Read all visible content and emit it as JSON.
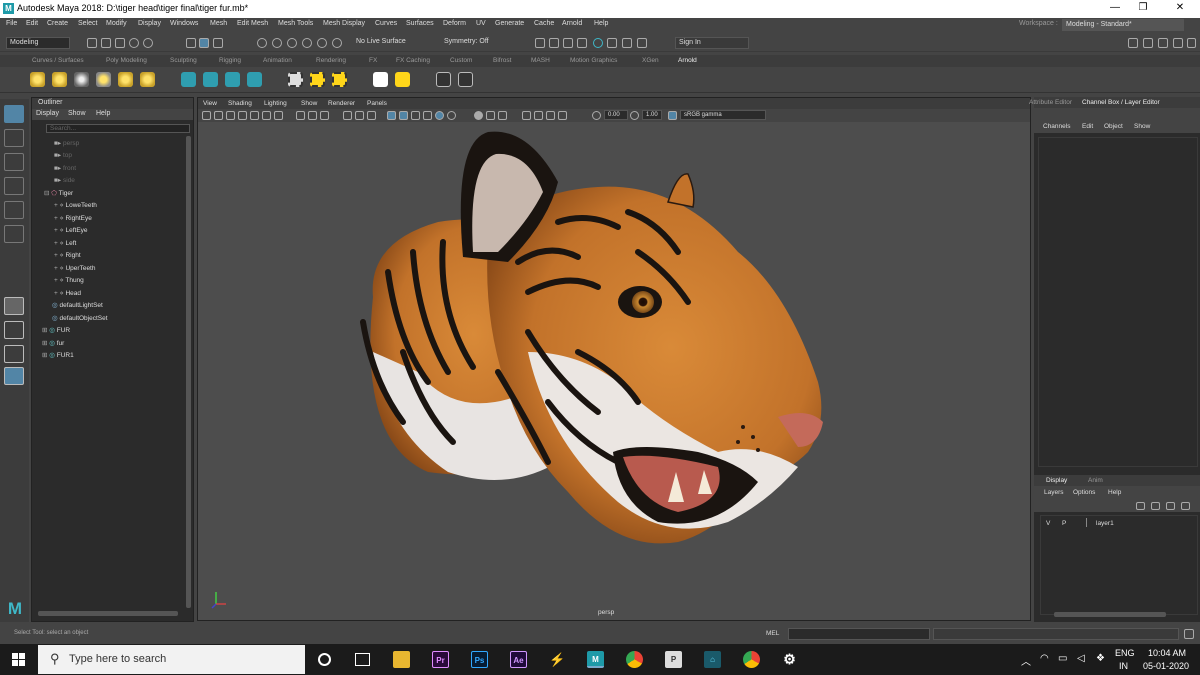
{
  "window": {
    "title": "Autodesk Maya 2018: D:\\tiger head\\tiger final\\tiger fur.mb*",
    "logo": "M",
    "minimize": "—",
    "maximize": "❐",
    "close": "✕"
  },
  "menu": [
    "File",
    "Edit",
    "Create",
    "Select",
    "Modify",
    "Display",
    "Windows",
    "Mesh",
    "Edit Mesh",
    "Mesh Tools",
    "Mesh Display",
    "Curves",
    "Surfaces",
    "Deform",
    "UV",
    "Generate",
    "Cache",
    "Arnold",
    "Help"
  ],
  "workspace": {
    "label": "Workspace :",
    "value": "Modeling - Standard*"
  },
  "statusline": {
    "mode": "Modeling",
    "live_surface": "No Live Surface",
    "symmetry": "Symmetry: Off",
    "sign_in": "Sign In"
  },
  "shelf_tabs": [
    "Curves / Surfaces",
    "Poly Modeling",
    "Sculpting",
    "Rigging",
    "Animation",
    "Rendering",
    "FX",
    "FX Caching",
    "Custom",
    "Bifrost",
    "MASH",
    "Motion Graphics",
    "XGen",
    "Arnold"
  ],
  "outliner": {
    "title": "Outliner",
    "menu": [
      "Display",
      "Show",
      "Help"
    ],
    "search_placeholder": "Search...",
    "cameras": [
      "persp",
      "top",
      "front",
      "side"
    ],
    "group": "Tiger",
    "children": [
      "LoweTeeth",
      "RightEye",
      "LeftEye",
      "Left",
      "Right",
      "UperTeeth",
      "Thung",
      "Head"
    ],
    "sets": [
      "defaultLightSet",
      "defaultObjectSet"
    ],
    "extras": [
      "FUR",
      "fur",
      "FUR1"
    ]
  },
  "viewport": {
    "menu": [
      "View",
      "Shading",
      "Lighting",
      "Show",
      "Renderer",
      "Panels"
    ],
    "field1": "0.00",
    "field2": "1.00",
    "colorspace": "sRGB gamma",
    "camera_label": "persp"
  },
  "channel_box": {
    "tab1": "Attribute Editor",
    "tab2": "Channel Box / Layer Editor",
    "menu": [
      "Channels",
      "Edit",
      "Object",
      "Show"
    ],
    "layer_tabs": [
      "Display",
      "Anim"
    ],
    "layer_menu": [
      "Layers",
      "Options",
      "Help"
    ],
    "layer": {
      "v": "V",
      "p": "P",
      "name": "layer1"
    }
  },
  "status": {
    "help": "Select Tool: select an object",
    "mel": "MEL"
  },
  "taskbar": {
    "search_placeholder": "Type here to search",
    "apps": [
      "Pr",
      "Ps",
      "Ae"
    ],
    "lang": "ENG",
    "region": "IN",
    "time": "10:04 AM",
    "date": "05-01-2020"
  },
  "colors": {
    "accent": "#5285a6",
    "maya_teal": "#1e9aa8",
    "tiger_orange": "#c8792a"
  }
}
